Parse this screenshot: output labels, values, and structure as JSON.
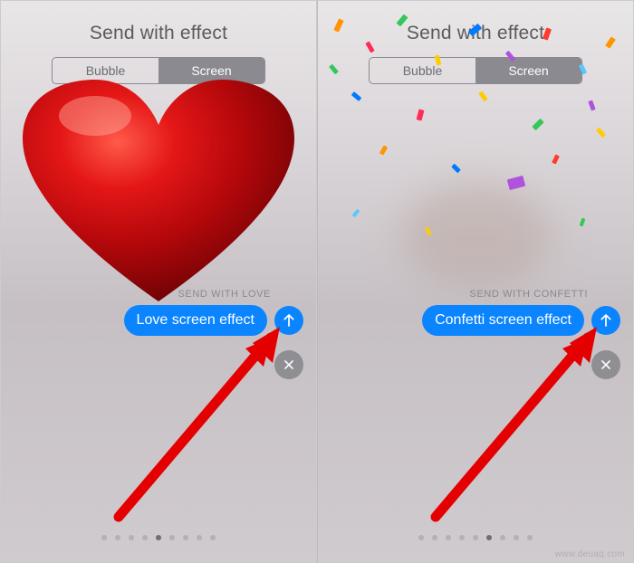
{
  "left": {
    "title": "Send with effect",
    "tabs": {
      "bubble": "Bubble",
      "screen": "Screen"
    },
    "effect_label": "SEND WITH LOVE",
    "bubble_text": "Love screen effect",
    "page_dots": {
      "count": 9,
      "active_index": 4
    }
  },
  "right": {
    "title": "Send with effect",
    "tabs": {
      "bubble": "Bubble",
      "screen": "Screen"
    },
    "effect_label": "SEND WITH CONFETTI",
    "bubble_text": "Confetti screen effect",
    "page_dots": {
      "count": 9,
      "active_index": 5
    }
  },
  "watermark": "www.deuaq.com",
  "colors": {
    "accent": "#0a84ff",
    "heart": "#b6080b",
    "close": "#8e8e93"
  }
}
